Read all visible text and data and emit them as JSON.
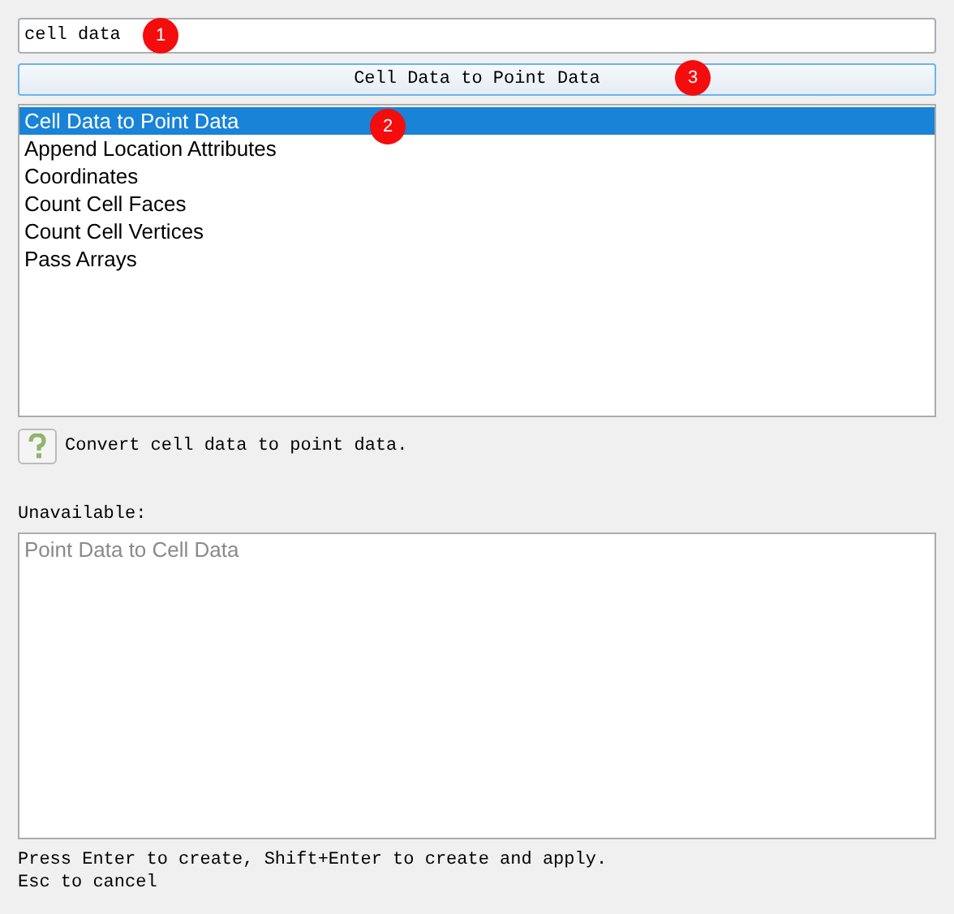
{
  "search": {
    "value": "cell data"
  },
  "create_button": {
    "label": "Cell Data to Point Data"
  },
  "available": [
    {
      "label": "Cell Data to Point Data",
      "selected": true
    },
    {
      "label": "Append Location Attributes",
      "selected": false
    },
    {
      "label": "Coordinates",
      "selected": false
    },
    {
      "label": "Count Cell Faces",
      "selected": false
    },
    {
      "label": "Count Cell Vertices",
      "selected": false
    },
    {
      "label": "Pass Arrays",
      "selected": false
    }
  ],
  "help": {
    "description": "Convert cell data to point data."
  },
  "unavailable": {
    "label": "Unavailable:",
    "items": [
      "Point Data to Cell Data"
    ]
  },
  "footer": [
    "Press Enter to create, Shift+Enter to create and apply.",
    "Esc to cancel"
  ],
  "markers": [
    {
      "label": "1"
    },
    {
      "label": "2"
    },
    {
      "label": "3"
    }
  ]
}
